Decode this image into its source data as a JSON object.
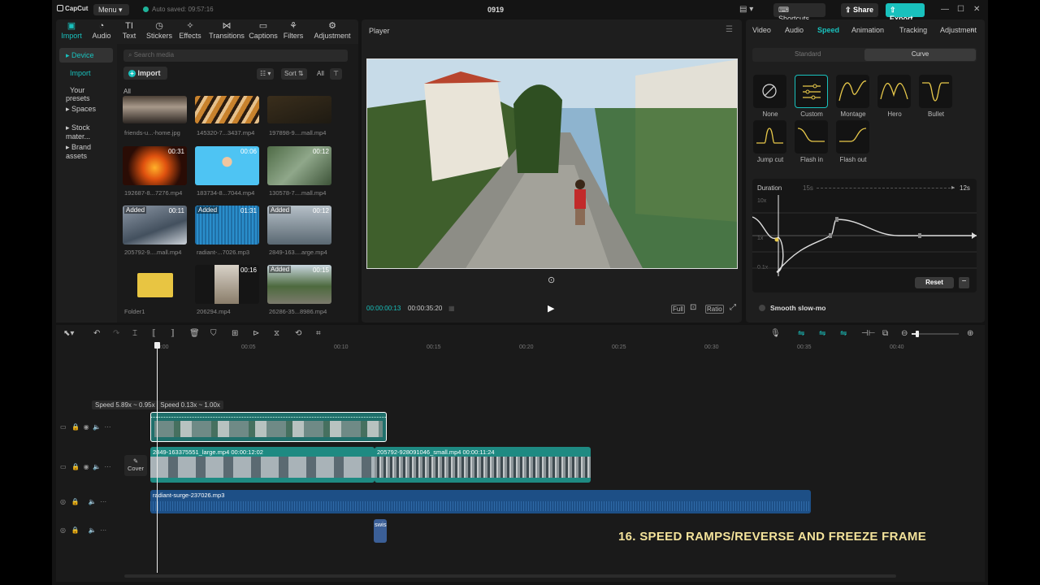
{
  "titlebar": {
    "app": "CapCut",
    "menu": "Menu",
    "autosave": "Auto saved: 09:57:16",
    "project": "0919",
    "shortcuts": "Shortcuts",
    "share": "Share",
    "export": "Export"
  },
  "media": {
    "tabs": [
      {
        "label": "Import",
        "icon": "import-icon"
      },
      {
        "label": "Audio",
        "icon": "audio-icon"
      },
      {
        "label": "Text",
        "icon": "text-icon"
      },
      {
        "label": "Stickers",
        "icon": "stickers-icon"
      },
      {
        "label": "Effects",
        "icon": "effects-icon"
      },
      {
        "label": "Transitions",
        "icon": "transitions-icon"
      },
      {
        "label": "Captions",
        "icon": "captions-icon"
      },
      {
        "label": "Filters",
        "icon": "filters-icon"
      },
      {
        "label": "Adjustment",
        "icon": "adjustment-icon"
      }
    ],
    "sidebar": [
      "Device",
      "Import",
      "Your presets",
      "Spaces",
      "Stock mater...",
      "Brand assets"
    ],
    "search_placeholder": "Search media",
    "import_label": "Import",
    "sort": "Sort",
    "filter_all": "All",
    "all_label": "All",
    "items": [
      {
        "name": "friends-u...-home.jpg",
        "duration": "",
        "added": false
      },
      {
        "name": "145320-7...3437.mp4",
        "duration": "",
        "added": false
      },
      {
        "name": "197898-9....mall.mp4",
        "duration": "",
        "added": false
      },
      {
        "name": "192687-8...7276.mp4",
        "duration": "00:31",
        "added": false
      },
      {
        "name": "183734-8...7044.mp4",
        "duration": "00:06",
        "added": false
      },
      {
        "name": "130578-7....mall.mp4",
        "duration": "00:12",
        "added": false
      },
      {
        "name": "205792-9....mall.mp4",
        "duration": "00:11",
        "added": true
      },
      {
        "name": "radiant-...7026.mp3",
        "duration": "01:31",
        "added": true
      },
      {
        "name": "2849-163....arge.mp4",
        "duration": "00:12",
        "added": true
      },
      {
        "name": "Folder1",
        "duration": "",
        "added": false
      },
      {
        "name": "206294.mp4",
        "duration": "00:16",
        "added": false
      },
      {
        "name": "26286-35...8986.mp4",
        "duration": "00:15",
        "added": true
      }
    ],
    "added_label": "Added"
  },
  "player": {
    "title": "Player",
    "current": "00:00:00:13",
    "total": "00:00:35:20",
    "full": "Full",
    "ratio": "Ratio"
  },
  "inspector": {
    "tabs": [
      "Video",
      "Audio",
      "Speed",
      "Animation",
      "Tracking",
      "Adjustment"
    ],
    "seg": [
      "Standard",
      "Curve"
    ],
    "presets": [
      "None",
      "Custom",
      "Montage",
      "Hero",
      "Bullet",
      "Jump cut",
      "Flash in",
      "Flash out"
    ],
    "duration_label": "Duration",
    "dur_from": "15s",
    "dur_to": "12s",
    "y_labels": [
      "10x",
      "1x",
      "0.1x"
    ],
    "reset": "Reset",
    "smooth": "Smooth slow-mo"
  },
  "timeline": {
    "ruler": [
      "00:00",
      "00:05",
      "00:10",
      "00:15",
      "00:20",
      "00:25",
      "00:30",
      "00:35",
      "00:40"
    ],
    "tip1": "Speed 5.89x ~ 0.95x",
    "tip2": "Speed 0.13x ~ 1.00x",
    "cover": "Cover",
    "clip1": "2849-163375551_large.mp4   00:00:12:02",
    "clip2": "205792-928091046_small.mp4   00:00:11:24",
    "audio": "radiant-surge-237026.mp3",
    "sfx": "swis"
  },
  "caption": "16. SPEED RAMPS/REVERSE AND FREEZE FRAME",
  "colors": {
    "accent": "#19c1bd",
    "caption": "#f3e29a",
    "audio_clip": "#1d4f86",
    "video_clip": "#1e8a82"
  }
}
